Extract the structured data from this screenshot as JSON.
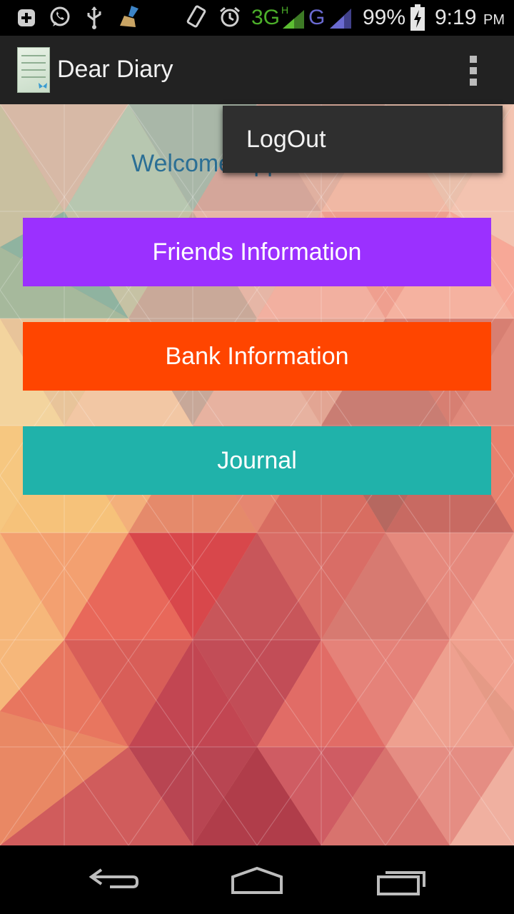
{
  "status_bar": {
    "network_1": "3G",
    "network_1_badge": "H",
    "network_2": "G",
    "battery": "99%",
    "time": "9:19",
    "ampm": "PM",
    "icons": [
      "add-icon",
      "whatsapp-icon",
      "usb-icon",
      "broom-icon",
      "vibrate-icon",
      "alarm-icon",
      "signal-icon",
      "battery-charging-icon"
    ]
  },
  "action_bar": {
    "title": "Dear Diary",
    "overflow_icon": "more-vertical-icon"
  },
  "main": {
    "welcome_text": "Welcome Appu",
    "buttons": [
      {
        "label": "Friends Information",
        "color": "#9b30ff"
      },
      {
        "label": "Bank Information",
        "color": "#ff4500"
      },
      {
        "label": "Journal",
        "color": "#20b2aa"
      }
    ]
  },
  "menu": {
    "items": [
      {
        "label": "LogOut"
      }
    ]
  },
  "nav_bar": {
    "icons": [
      "back-icon",
      "home-icon",
      "recents-icon"
    ]
  },
  "colors": {
    "welcome_text": "#2b6f95",
    "action_bar": "#222222"
  }
}
